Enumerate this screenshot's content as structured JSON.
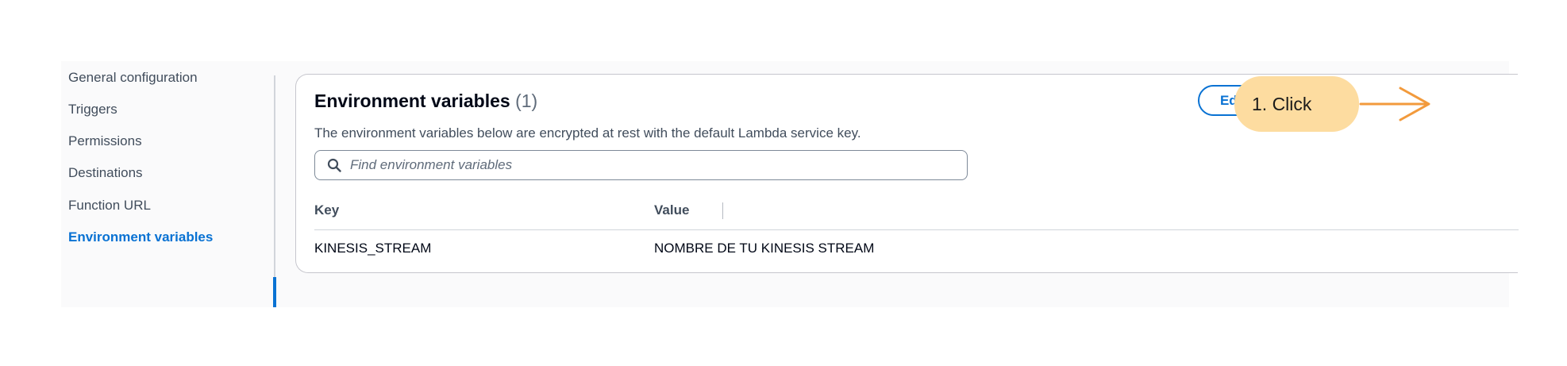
{
  "sidebar": {
    "items": [
      {
        "label": "General configuration"
      },
      {
        "label": "Triggers"
      },
      {
        "label": "Permissions"
      },
      {
        "label": "Destinations"
      },
      {
        "label": "Function URL"
      },
      {
        "label": "Environment variables",
        "active": true
      }
    ]
  },
  "panel": {
    "title": "Environment variables",
    "count": "(1)",
    "description": "The environment variables below are encrypted at rest with the default Lambda service key.",
    "edit_label": "Edit",
    "search": {
      "placeholder": "Find environment variables",
      "value": ""
    },
    "table": {
      "columns": [
        "Key",
        "Value"
      ],
      "rows": [
        {
          "key": "KINESIS_STREAM",
          "value": "NOMBRE DE TU KINESIS STREAM"
        }
      ]
    }
  },
  "annotation": {
    "label": "1. Click"
  },
  "colors": {
    "accent": "#0972d3",
    "callout": "#fddca0",
    "arrow": "#f29a3c"
  }
}
